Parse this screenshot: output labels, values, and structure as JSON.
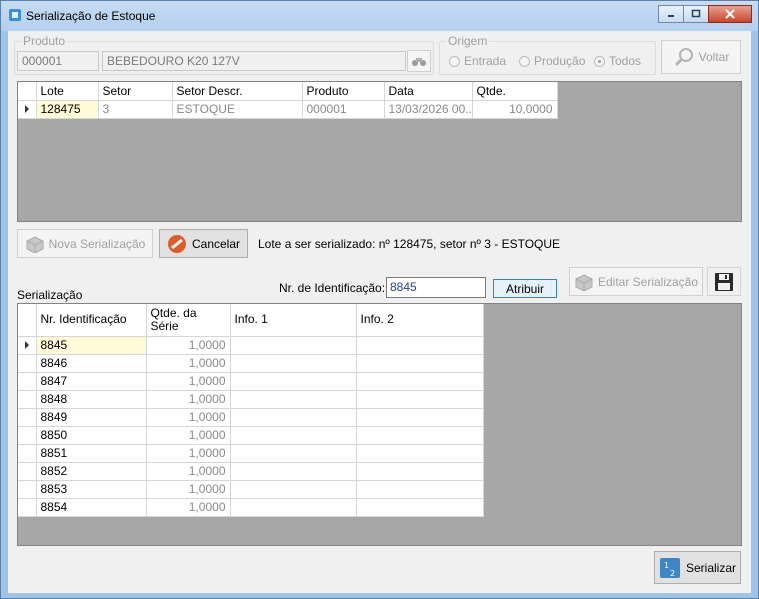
{
  "window": {
    "title": "Serialização de Estoque"
  },
  "produto": {
    "legend": "Produto",
    "code": "000001",
    "description": "BEBEDOURO K20 127V"
  },
  "origem": {
    "legend": "Origem",
    "options": [
      "Entrada",
      "Produção",
      "Todos"
    ],
    "selected": "Todos"
  },
  "voltar_label": "Voltar",
  "lote_grid": {
    "columns": [
      "Lote",
      "Setor",
      "Setor Descr.",
      "Produto",
      "Data",
      "Qtde."
    ],
    "rows": [
      [
        "128475",
        "3",
        "ESTOQUE",
        "000001",
        "13/03/2026 00...",
        "10,0000"
      ]
    ]
  },
  "actions": {
    "nova_label": "Nova Serialização",
    "cancelar_label": "Cancelar",
    "status_text": "Lote a ser serializado: nº 128475, setor nº 3 - ESTOQUE"
  },
  "serializacao": {
    "section_label": "Serialização",
    "id_label": "Nr. de Identificação:",
    "id_value": "8845",
    "atribuir_label": "Atribuir",
    "editar_label": "Editar Serialização"
  },
  "serial_grid": {
    "columns": [
      "Nr. Identificação",
      "Qtde. da Série",
      "Info. 1",
      "Info. 2"
    ],
    "rows": [
      [
        "8845",
        "1,0000",
        "",
        ""
      ],
      [
        "8846",
        "1,0000",
        "",
        ""
      ],
      [
        "8847",
        "1,0000",
        "",
        ""
      ],
      [
        "8848",
        "1,0000",
        "",
        ""
      ],
      [
        "8849",
        "1,0000",
        "",
        ""
      ],
      [
        "8850",
        "1,0000",
        "",
        ""
      ],
      [
        "8851",
        "1,0000",
        "",
        ""
      ],
      [
        "8852",
        "1,0000",
        "",
        ""
      ],
      [
        "8853",
        "1,0000",
        "",
        ""
      ],
      [
        "8854",
        "1,0000",
        "",
        ""
      ]
    ]
  },
  "serializar_label": "Serializar",
  "icons": {
    "title": "app-icon",
    "search": "binoculars-icon",
    "voltar": "magnifier-icon",
    "nova": "box-icon",
    "cancelar": "cancel-icon",
    "save": "floppy-icon",
    "serializar": "serialize-icon"
  }
}
